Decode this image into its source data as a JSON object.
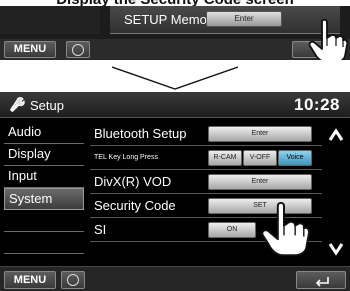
{
  "top_excerpt": {
    "caption": "Display the Security Code screen",
    "row_label": "SETUP Memory",
    "row_button": "Enter",
    "menu_button": "MENU"
  },
  "header": {
    "title": "Setup",
    "clock": "10:28"
  },
  "sidebar": {
    "items": [
      {
        "label": "Audio"
      },
      {
        "label": "Display"
      },
      {
        "label": "Input"
      },
      {
        "label": "System",
        "selected": true
      }
    ]
  },
  "rows": [
    {
      "label": "Bluetooth Setup",
      "button": "Enter"
    },
    {
      "label": "TEL Key Long Press",
      "options": [
        "R-CAM",
        "V-OFF",
        "Voice"
      ],
      "active_option": "Voice"
    },
    {
      "label": "DivX(R) VOD",
      "button": "Enter"
    },
    {
      "label": "Security Code",
      "button": "SET"
    },
    {
      "label": "SI",
      "button": "ON"
    }
  ],
  "bottom_bar": {
    "menu_button": "MENU"
  },
  "icons": {
    "header": "wrench-setup-icon",
    "scroll_up": "chevron-up-icon",
    "scroll_down": "chevron-down-icon",
    "back": "back-arrow-icon",
    "home": "home-circle-icon",
    "hand": "pointing-hand-icon"
  },
  "colors": {
    "active_option": "#5fb4d9",
    "screen_background": "#000000"
  }
}
